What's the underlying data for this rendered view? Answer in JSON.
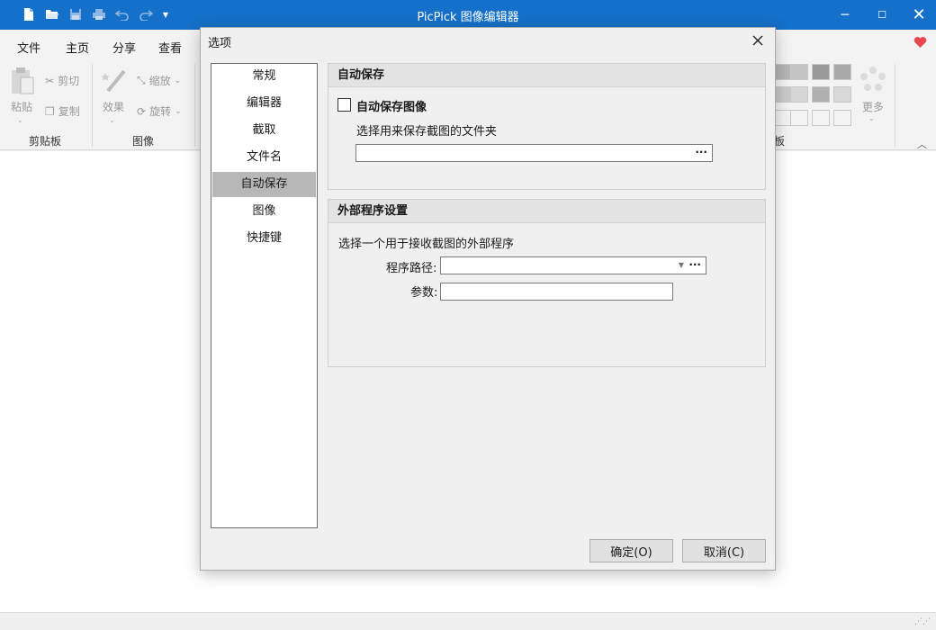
{
  "window": {
    "title": "PicPick 图像编辑器"
  },
  "ribbon": {
    "tabs": [
      "文件",
      "主页",
      "分享",
      "查看"
    ],
    "active_tab": "主页",
    "clipboard": {
      "paste": "粘贴",
      "cut": "剪切",
      "copy": "复制",
      "group": "剪贴板"
    },
    "image": {
      "effects": "效果",
      "resize": "缩放",
      "rotate": "旋转",
      "group": "图像"
    },
    "more": "更多",
    "partial_group": "板"
  },
  "dialog": {
    "title": "选项",
    "nav": [
      "常规",
      "编辑器",
      "截取",
      "文件名",
      "自动保存",
      "图像",
      "快捷键"
    ],
    "selected_nav": "自动保存",
    "autosave": {
      "heading": "自动保存",
      "checkbox_label": "自动保存图像",
      "checked": false,
      "folder_prompt": "选择用来保存截图的文件夹",
      "folder_value": ""
    },
    "external": {
      "heading": "外部程序设置",
      "prompt": "选择一个用于接收截图的外部程序",
      "path_label": "程序路径:",
      "path_value": "",
      "args_label": "参数:",
      "args_value": ""
    },
    "buttons": {
      "ok": "确定(O)",
      "cancel": "取消(C)"
    }
  },
  "colors": {
    "titlebar": "#1470c8",
    "accent": "#1470c8",
    "selected_nav": "#b7b7b7"
  }
}
